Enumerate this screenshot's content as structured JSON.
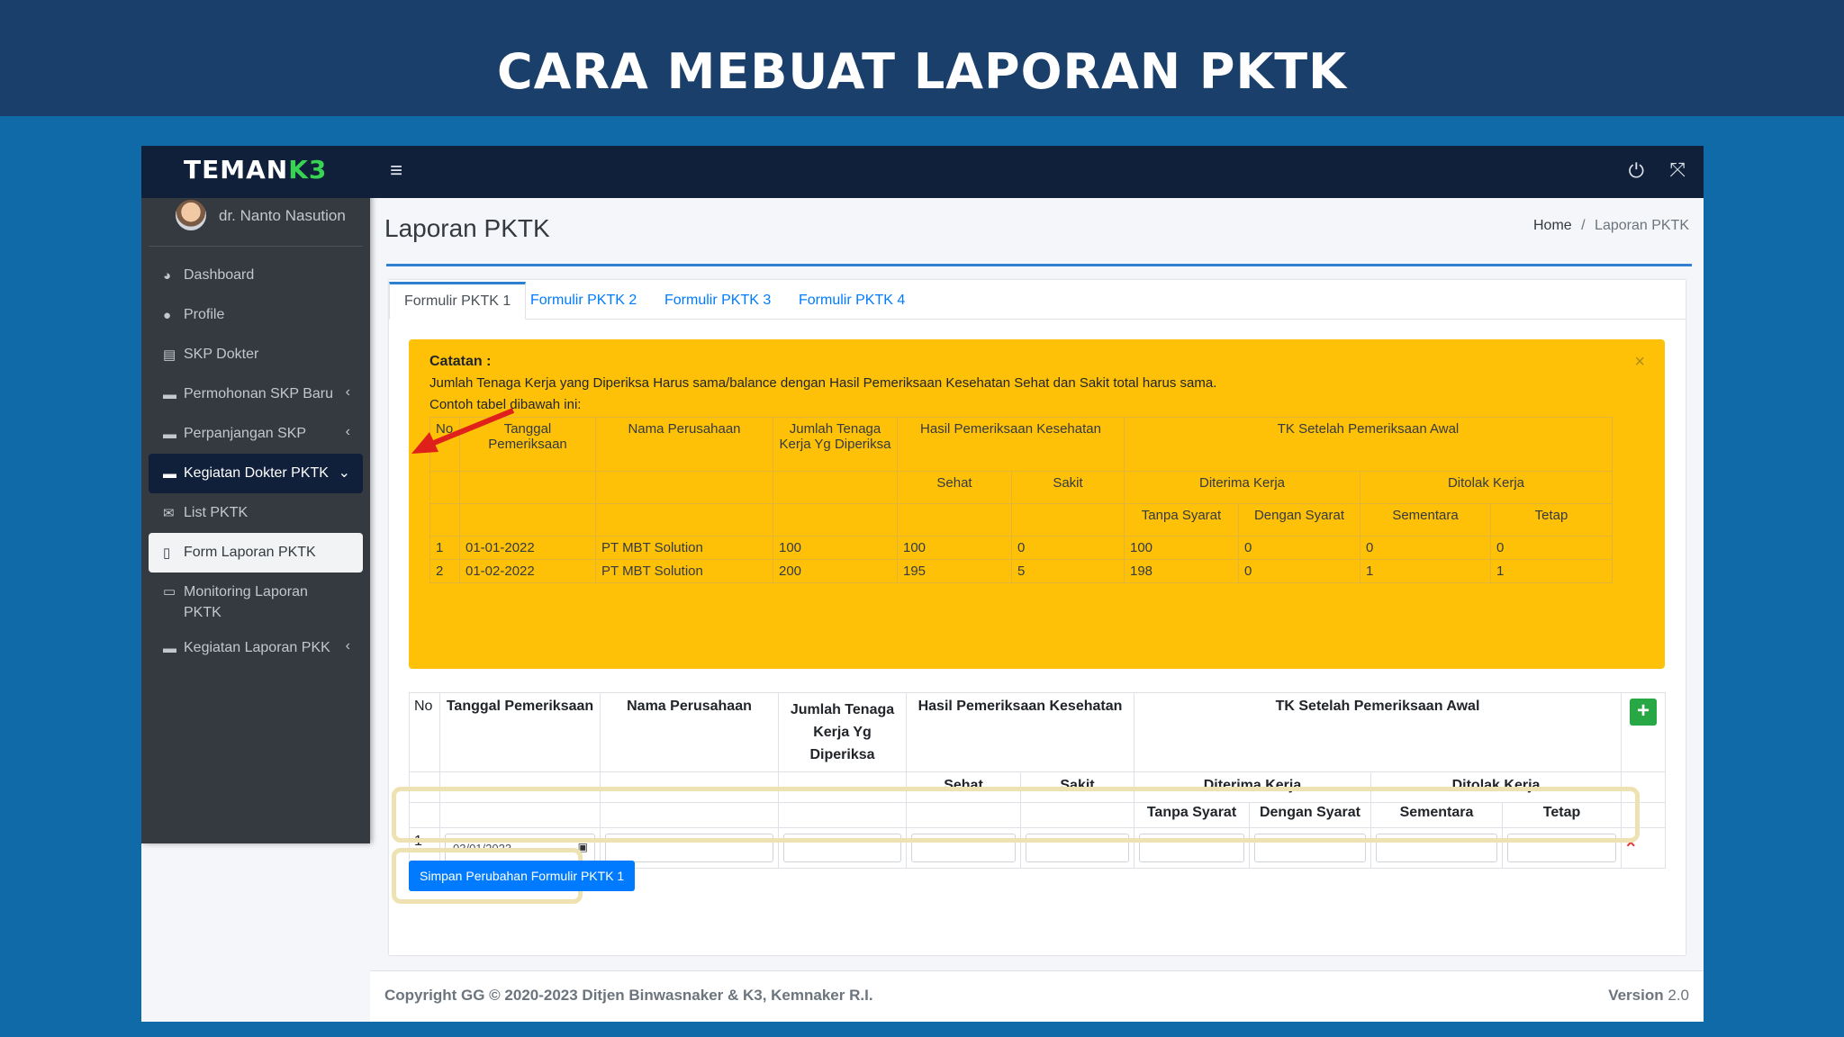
{
  "slide": {
    "title": "CARA MEBUAT LAPORAN PKTK"
  },
  "brand": {
    "left": "TEMAN",
    "right": "K3"
  },
  "user": {
    "name": "dr. Nanto Nasution"
  },
  "topbar": {
    "menu_icon": "hamburger-icon",
    "power_icon": "power-icon",
    "fullscreen_icon": "expand-icon"
  },
  "sidebar": {
    "items": [
      {
        "label": "Dashboard",
        "icon": "dashboard-icon"
      },
      {
        "label": "Profile",
        "icon": "user-icon"
      },
      {
        "label": "SKP Dokter",
        "icon": "id-card-icon"
      },
      {
        "label": "Permohonan SKP Baru",
        "icon": "folder-icon"
      },
      {
        "label": "Perpanjangan SKP",
        "icon": "folder-icon"
      },
      {
        "label": "Kegiatan Dokter PKTK",
        "icon": "folder-open-icon"
      },
      {
        "label": "List PKTK",
        "icon": "envelope-icon"
      },
      {
        "label": "Form Laporan PKTK",
        "icon": "file-icon"
      },
      {
        "label": "Monitoring Laporan PKTK",
        "icon": "laptop-icon"
      },
      {
        "label": "Kegiatan Laporan PKK",
        "icon": "folder-icon"
      }
    ]
  },
  "page": {
    "title": "Laporan PKTK"
  },
  "breadcrumb": {
    "home": "Home",
    "sep": "/",
    "current": "Laporan PKTK"
  },
  "tabs": [
    "Formulir PKTK 1",
    "Formulir PKTK 2",
    "Formulir PKTK 3",
    "Formulir PKTK 4"
  ],
  "alert": {
    "heading": "Catatan :",
    "line1": "Jumlah Tenaga Kerja yang Diperiksa Harus sama/balance dengan Hasil Pemeriksaan Kesehatan Sehat dan Sakit total harus sama.",
    "line2": "Contoh tabel dibawah ini:",
    "close": "×",
    "table": {
      "h_no": "No",
      "h_tanggal": "Tanggal Pemeriksaan",
      "h_nama": "Nama Perusahaan",
      "h_jumlah": "Jumlah Tenaga Kerja Yg Diperiksa",
      "h_hasil": "Hasil Pemeriksaan Kesehatan",
      "h_tk": "TK Setelah Pemeriksaan Awal",
      "h_sehat": "Sehat",
      "h_sakit": "Sakit",
      "h_diterima": "Diterima Kerja",
      "h_ditolak": "Ditolak Kerja",
      "h_tanpa": "Tanpa Syarat",
      "h_dengan": "Dengan Syarat",
      "h_sementara": "Sementara",
      "h_tetap": "Tetap",
      "rows": [
        [
          "1",
          "01-01-2022",
          "PT MBT Solution",
          "100",
          "100",
          "0",
          "100",
          "0",
          "0",
          "0"
        ],
        [
          "2",
          "01-02-2022",
          "PT MBT Solution",
          "200",
          "195",
          "5",
          "198",
          "0",
          "1",
          "1"
        ]
      ]
    }
  },
  "entry": {
    "h_no": "No",
    "h_tanggal": "Tanggal Pemeriksaan",
    "h_nama": "Nama Perusahaan",
    "h_jumlah": "Jumlah Tenaga Kerja Yg Diperiksa",
    "h_hasil": "Hasil Pemeriksaan Kesehatan",
    "h_tk": "TK Setelah Pemeriksaan Awal",
    "h_sehat": "Sehat",
    "h_sakit": "Sakit",
    "h_diterima": "Diterima Kerja",
    "h_ditolak": "Ditolak Kerja",
    "h_tanpa": "Tanpa Syarat",
    "h_dengan": "Dengan Syarat",
    "h_sementara": "Sementara",
    "h_tetap": "Tetap",
    "row_no": "1",
    "date_value": "03/01/2023",
    "add_label": "+",
    "remove_label": "×"
  },
  "save_button": "Simpan Perubahan Formulir PKTK 1",
  "footer": {
    "copyright": "Copyright GG © 2020-2023 Ditjen Binwasnaker & K3, Kemnaker R.I.",
    "version_label": "Version",
    "version": "2.0"
  },
  "colors": {
    "slide_header": "#1a3f6b",
    "slide_bg": "#0f6aa7",
    "alert": "#ffc107",
    "primary": "#007bff",
    "success": "#28a745",
    "sidebar": "#343a40",
    "topbar": "#101f3a",
    "brand_accent": "#39d353"
  }
}
